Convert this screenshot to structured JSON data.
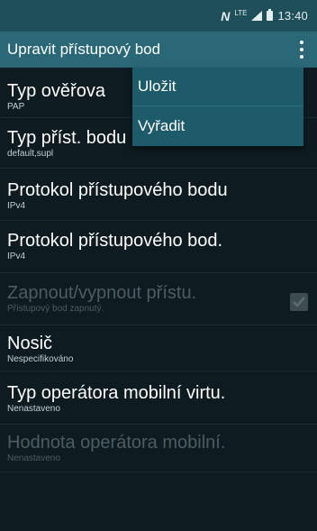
{
  "status_bar": {
    "nfc_label": "N",
    "network_label": "LTE",
    "time": "13:40",
    "icons": [
      "nfc-icon",
      "lte-icon",
      "signal-icon",
      "battery-icon"
    ]
  },
  "action_bar": {
    "title": "Upravit přístupový bod",
    "overflow_icon": "more-vert-icon"
  },
  "overflow_menu": {
    "items": [
      {
        "label": "Uložit"
      },
      {
        "label": "Vyřadit"
      }
    ]
  },
  "settings": [
    {
      "title": "Typ ověřova",
      "subtitle": "PAP",
      "enabled": true
    },
    {
      "title": "Typ příst. bodu",
      "subtitle": "default,supl",
      "enabled": true
    },
    {
      "title": "Protokol přístupového bodu",
      "subtitle": "IPv4",
      "enabled": true
    },
    {
      "title": "Protokol přístupového bod.",
      "subtitle": "IPv4",
      "enabled": true
    },
    {
      "title": "Zapnout/vypnout přístu.",
      "subtitle": "Přístupový bod zapnutý.",
      "enabled": false,
      "checkbox": true,
      "checked": true
    },
    {
      "title": "Nosič",
      "subtitle": "Nespecifikováno",
      "enabled": true
    },
    {
      "title": "Typ operátora mobilní virtu.",
      "subtitle": "Nenastaveno",
      "enabled": true
    },
    {
      "title": "Hodnota operátora mobilní.",
      "subtitle": "Nenastaveno",
      "enabled": false
    }
  ],
  "colors": {
    "status_bar": "#1f4f5b",
    "action_bar": "#2a6878",
    "menu": "#1d5a6a",
    "background": "#0e1b20",
    "disabled_text": "#4d5d62"
  }
}
